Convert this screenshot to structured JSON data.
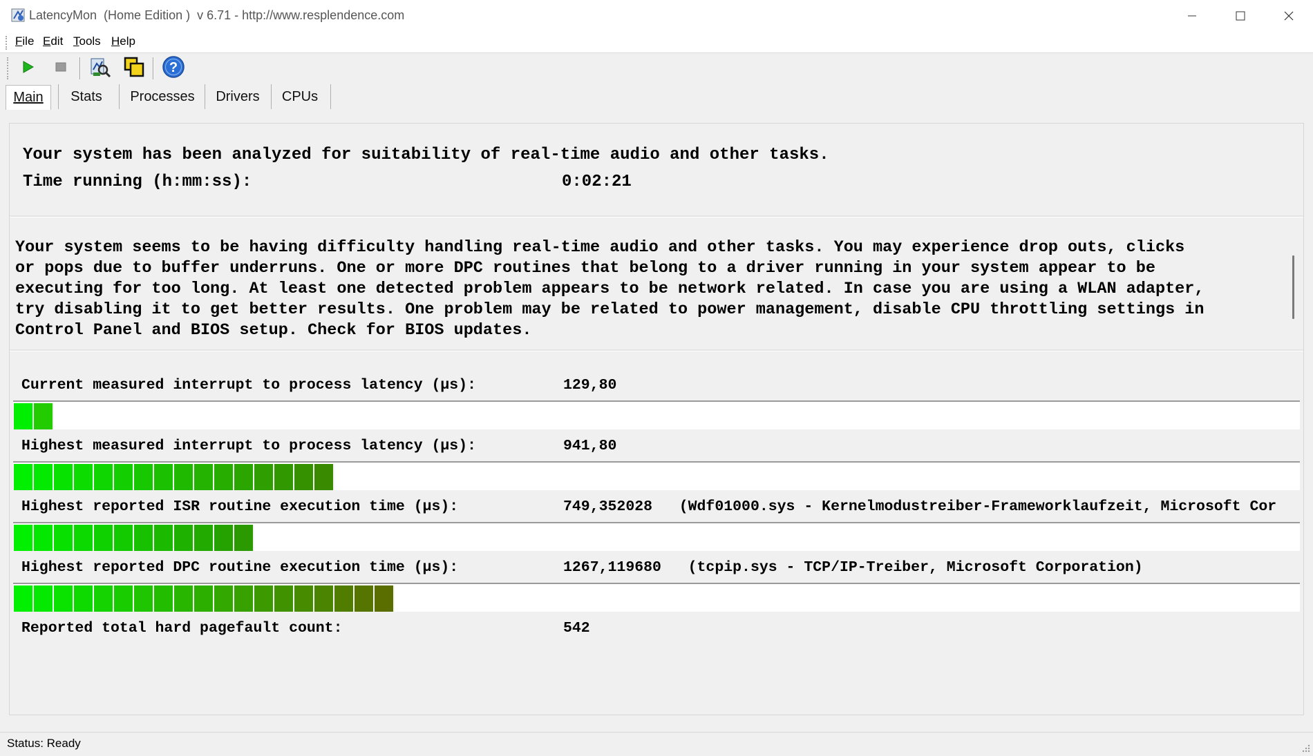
{
  "window": {
    "title": "LatencyMon  (Home Edition )  v 6.71 - http://www.resplendence.com",
    "controls": {
      "minimize": "minimize-icon",
      "maximize": "maximize-icon",
      "close": "close-icon"
    }
  },
  "menu": [
    {
      "mnemonic": "F",
      "rest": "ile"
    },
    {
      "mnemonic": "E",
      "rest": "dit"
    },
    {
      "mnemonic": "T",
      "rest": "ools"
    },
    {
      "mnemonic": "H",
      "rest": "elp"
    }
  ],
  "toolbar": {
    "buttons": [
      "play-icon",
      "stop-icon",
      "analyze-icon",
      "copy-windows-icon",
      "help-icon"
    ]
  },
  "tabs": [
    "Main",
    "Stats",
    "Processes",
    "Drivers",
    "CPUs"
  ],
  "active_tab": "Main",
  "summary": {
    "headline": "Your system has been analyzed for suitability of real-time audio and other tasks.",
    "time_label": "Time running (h:mm:ss):",
    "time_value": "0:02:21"
  },
  "message": "Your system seems to be having difficulty handling real-time audio and other tasks. You may experience drop outs, clicks\nor pops due to buffer underruns. One or more DPC routines that belong to a driver running in your system appear to be\nexecuting for too long. At least one detected problem appears to be network related. In case you are using a WLAN adapter,\ntry disabling it to get better results. One problem may be related to power management, disable CPU throttling settings in\nControl Panel and BIOS setup. Check for BIOS updates.",
  "metrics": [
    {
      "label": "Current measured interrupt to process latency (µs):",
      "value": "129,80",
      "segments": 2,
      "color_from": "#00ee00",
      "color_to": "#22cc00"
    },
    {
      "label": "Highest measured interrupt to process latency (µs):",
      "value": "941,80",
      "segments": 16,
      "color_from": "#00f000",
      "color_to": "#3a8a00"
    },
    {
      "label": "Highest reported ISR routine execution time (µs):",
      "value": "749,352028   (Wdf01000.sys - Kernelmodustreiber-Frameworklaufzeit, Microsoft Cor",
      "segments": 12,
      "color_from": "#00f000",
      "color_to": "#2a9a00"
    },
    {
      "label": "Highest reported DPC routine execution time (µs):",
      "value": "1267,119680   (tcpip.sys - TCP/IP-Treiber, Microsoft Corporation)",
      "segments": 19,
      "color_from": "#00f000",
      "color_to": "#5a6e00"
    }
  ],
  "pagefault": {
    "label": "Reported total hard pagefault count:",
    "value": "542"
  },
  "status": "Status: Ready"
}
